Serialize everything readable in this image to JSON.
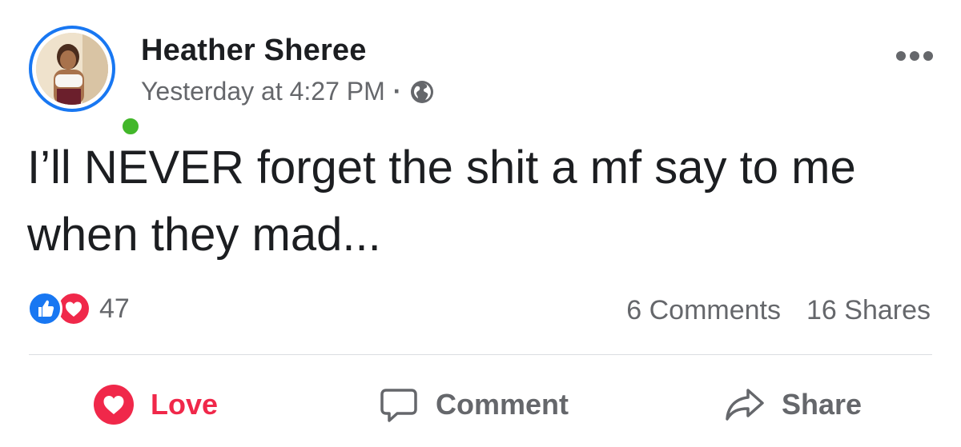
{
  "author": {
    "name": "Heather Sheree",
    "online": true
  },
  "meta": {
    "timestamp": "Yesterday at 4:27 PM",
    "separator": "·",
    "privacy_icon": "globe-icon"
  },
  "post": {
    "text": "I’ll NEVER forget the shit a mf say to me when they mad..."
  },
  "reactions": {
    "types": [
      "like",
      "love"
    ],
    "count": "47"
  },
  "engagement": {
    "comments": "6 Comments",
    "shares": "16 Shares"
  },
  "actions": {
    "love_label": "Love",
    "comment_label": "Comment",
    "share_label": "Share"
  },
  "colors": {
    "brand_blue": "#1877f2",
    "love_red": "#f0284a",
    "online_green": "#42b72a",
    "secondary_text": "#65676b",
    "primary_text": "#1c1e21"
  }
}
